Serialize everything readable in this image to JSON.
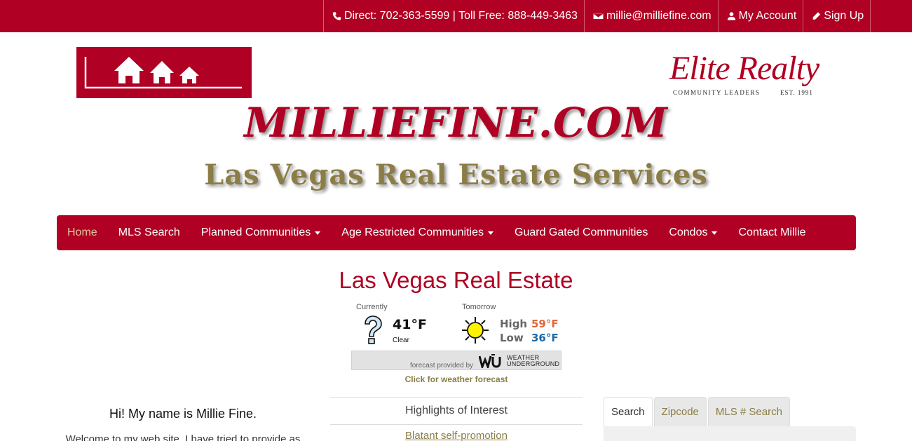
{
  "topbar": {
    "direct": "Direct: 702-363-5599 | Toll Free: 888-449-3463",
    "email": "millie@milliefine.com",
    "account": "My Account",
    "signup": "Sign Up"
  },
  "header": {
    "brand_logo": "Elite Realty",
    "brand_tagline": "COMMUNITY LEADERS",
    "brand_est": "EST. 1991",
    "site_title": "MILLIEFINE.COM",
    "site_subtitle": "Las Vegas Real Estate Services"
  },
  "nav": {
    "items": [
      {
        "label": "Home",
        "active": true
      },
      {
        "label": "MLS Search"
      },
      {
        "label": "Planned Communities",
        "dropdown": true
      },
      {
        "label": "Age Restricted Communities",
        "dropdown": true
      },
      {
        "label": "Guard Gated Communities"
      },
      {
        "label": "Condos",
        "dropdown": true
      },
      {
        "label": "Contact Millie"
      }
    ]
  },
  "main": {
    "heading": "Las Vegas Real Estate"
  },
  "weather": {
    "currently_label": "Currently",
    "tomorrow_label": "Tomorrow",
    "current_temp": "41°F",
    "current_condition": "Clear",
    "high_label": "High",
    "high_temp": "59°F",
    "low_label": "Low",
    "low_temp": "36°F",
    "provided_by": "forecast provided by",
    "provider_line1": "WEATHER",
    "provider_line2": "UNDERGROUND",
    "click_text": "Click for weather forecast"
  },
  "intro": {
    "greeting": "Hi! My name is Millie Fine.",
    "welcome": "Welcome to my web site. I have tried to provide as"
  },
  "highlights": {
    "title": "Highlights of Interest",
    "first_link": "Blatant self-promotion"
  },
  "search_tabs": [
    {
      "label": "Search",
      "active": true
    },
    {
      "label": "Zipcode"
    },
    {
      "label": "MLS # Search"
    }
  ],
  "colors": {
    "brand_red": "#b00023",
    "gold": "#8b7d45"
  }
}
